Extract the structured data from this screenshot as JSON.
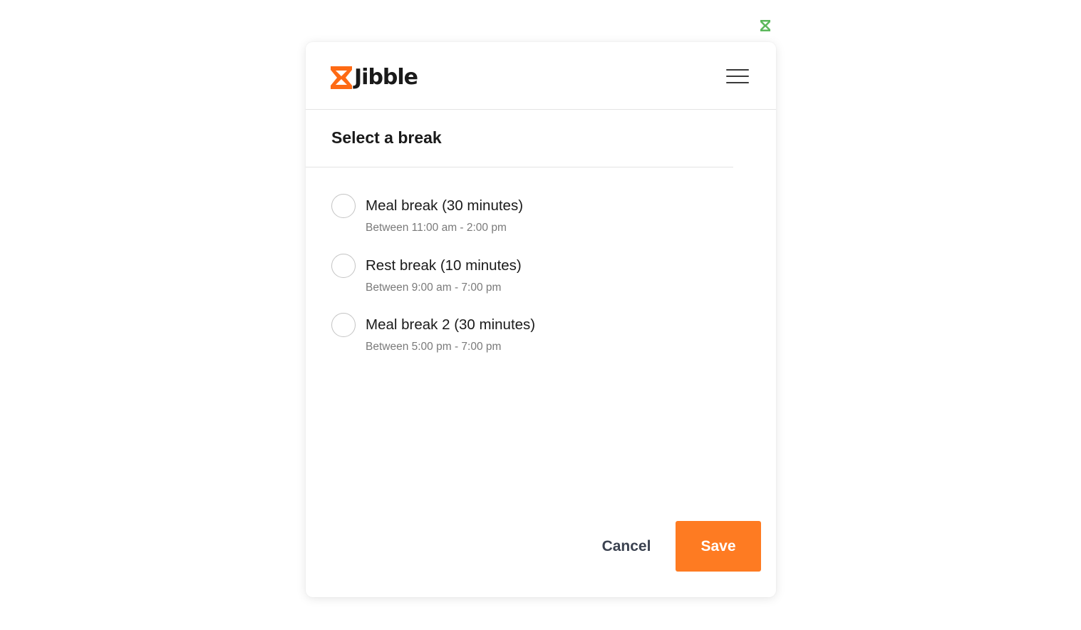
{
  "extension": {
    "icon": "hourglass-icon",
    "color": "#5cb85c"
  },
  "header": {
    "brand_name": "Jibble",
    "brand_color": "#fe6a14",
    "menu_icon": "hamburger-menu-icon"
  },
  "dialog": {
    "title": "Select a break",
    "options": [
      {
        "label": "Meal break (30 minutes)",
        "window": "Between 11:00 am - 2:00 pm",
        "selected": false
      },
      {
        "label": "Rest break (10 minutes)",
        "window": "Between 9:00 am - 7:00 pm",
        "selected": false
      },
      {
        "label": "Meal break 2 (30 minutes)",
        "window": "Between 5:00 pm - 7:00 pm",
        "selected": false
      }
    ]
  },
  "actions": {
    "cancel_label": "Cancel",
    "save_label": "Save",
    "accent_color": "#fe7b22"
  }
}
